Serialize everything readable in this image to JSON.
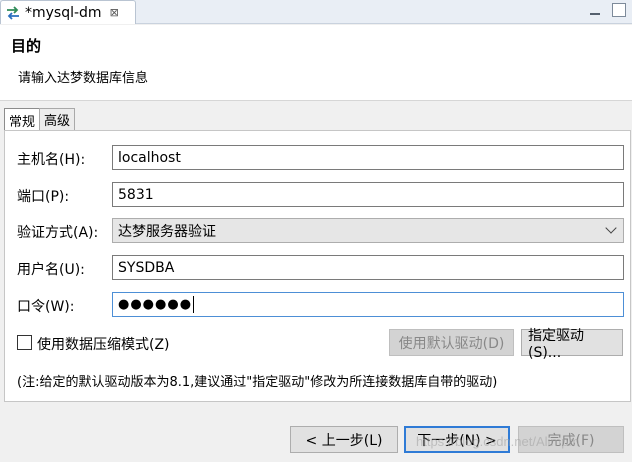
{
  "window": {
    "tab_title": "*mysql-dm",
    "tab_close": "⊠"
  },
  "header": {
    "title": "目的",
    "description": "请输入达梦数据库信息"
  },
  "tabs": [
    {
      "label": "常规",
      "active": true
    },
    {
      "label": "高级",
      "active": false
    }
  ],
  "form": {
    "host": {
      "label": "主机名(H):",
      "value": "localhost"
    },
    "port": {
      "label": "端口(P):",
      "value": "5831"
    },
    "auth": {
      "label": "验证方式(A):",
      "value": "达梦服务器验证"
    },
    "user": {
      "label": "用户名(U):",
      "value": "SYSDBA"
    },
    "password": {
      "label": "口令(W):",
      "value": "●●●●●●"
    },
    "compress": {
      "label": "使用数据压缩模式(Z)",
      "checked": false
    }
  },
  "buttons": {
    "default_driver": "使用默认驱动(D)",
    "specify_driver": "指定驱动(S)...",
    "back": "< 上一步(L)",
    "next": "下一步(N) >",
    "finish": "完成(F)"
  },
  "note": "(注:给定的默认驱动版本为8.1,建议通过\"指定驱动\"修改为所连接数据库自带的驱动)",
  "watermark": "https://blog.csdn.net/Alimpm",
  "colors": {
    "focus_border": "#4d8fd6",
    "header_bg": "#ffffff"
  }
}
